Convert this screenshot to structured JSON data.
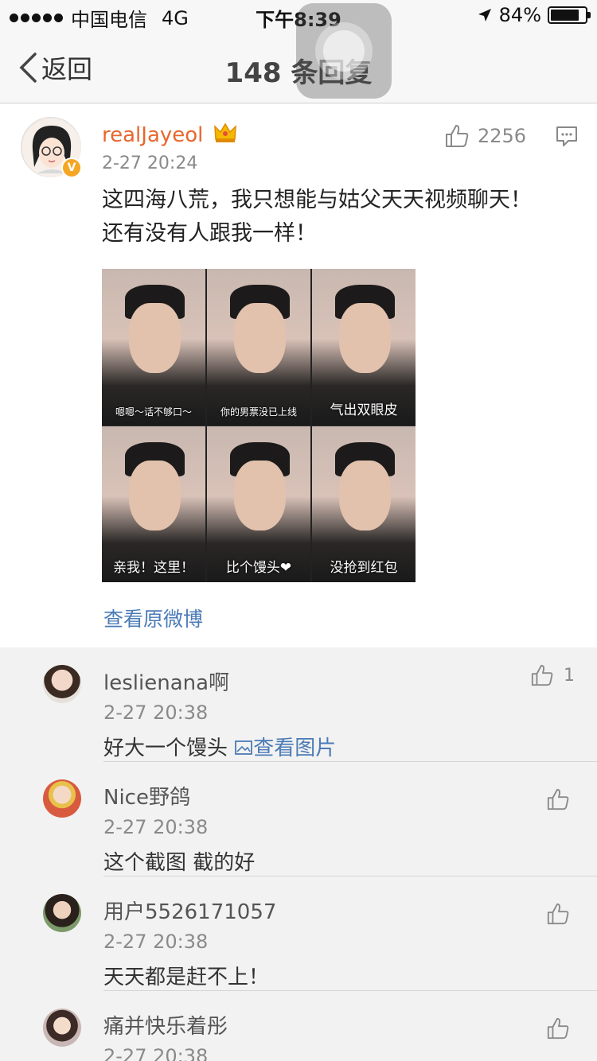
{
  "status_bar": {
    "carrier": "中国电信",
    "network": "4G",
    "time": "下午8:39",
    "battery": "84%",
    "battery_level": 0.84
  },
  "nav": {
    "back_label": "返回",
    "title": "148 条回复"
  },
  "post": {
    "username": "realJayeol",
    "time": "2-27 20:24",
    "like_count": "2256",
    "text": "这四海八荒，我只想能与姑父天天视频聊天！还有没有人跟我一样！",
    "image_captions": [
      "嗯嗯～话不够口～",
      "你的男票没已上线",
      "气出双眼皮",
      "亲我！这里！",
      "比个馒头❤",
      "没抢到红包"
    ],
    "view_original": "查看原微博"
  },
  "comments": [
    {
      "name": "leslienana啊",
      "time": "2-27 20:38",
      "text": "好大一个馒头",
      "link": "查看图片",
      "likes": "1",
      "avatar_color": "#c9a58d"
    },
    {
      "name": "Nice野鸽",
      "time": "2-27 20:38",
      "text": "这个截图  截的好",
      "avatar_color": "#d85a3f"
    },
    {
      "name": "用户5526171057",
      "time": "2-27 20:38",
      "text": "天天都是赶不上！",
      "avatar_color": "#6f5a4a"
    },
    {
      "name": "痛并快乐着彤",
      "time": "2-27 20:38",
      "text": "",
      "avatar_color": "#8a6e6a"
    }
  ]
}
